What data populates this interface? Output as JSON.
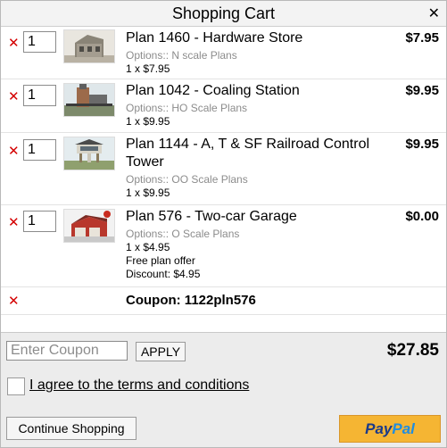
{
  "window": {
    "title": "Shopping Cart",
    "close_glyph": "✕"
  },
  "remove_glyph": "✕",
  "items": [
    {
      "qty": "1",
      "name": "Plan 1460 - Hardware Store",
      "options": "Options:: N scale Plans",
      "lines": [
        "1 x $7.95"
      ],
      "price": "$7.95",
      "thumb_icon": "hardware-store-model"
    },
    {
      "qty": "1",
      "name": "Plan 1042 - Coaling Station",
      "options": "Options:: HO Scale Plans",
      "lines": [
        "1 x $9.95"
      ],
      "price": "$9.95",
      "thumb_icon": "coaling-station-model"
    },
    {
      "qty": "1",
      "name": "Plan 1144 - A, T & SF Railroad Control Tower",
      "options": "Options:: OO Scale Plans",
      "lines": [
        "1 x $9.95"
      ],
      "price": "$9.95",
      "thumb_icon": "control-tower-model"
    },
    {
      "qty": "1",
      "name": "Plan 576 - Two-car Garage",
      "options": "Options:: O Scale Plans",
      "lines": [
        "1 x $4.95",
        "Free plan offer",
        "Discount: $4.95"
      ],
      "price": "$0.00",
      "thumb_icon": "garage-model"
    }
  ],
  "coupon": {
    "label": "Coupon: 1122pln576"
  },
  "footer": {
    "coupon_placeholder": "Enter Coupon",
    "apply_label": "APPLY",
    "total": "$27.85",
    "terms_label": "I agree to the terms and conditions",
    "continue_label": "Continue Shopping",
    "paypal_part1": "Pay",
    "paypal_part2": "Pal"
  },
  "colors": {
    "remove": "#d40000",
    "paypal_bg": "#f5b533",
    "paypal_dark": "#1a3a8a",
    "paypal_light": "#1f8de0"
  }
}
